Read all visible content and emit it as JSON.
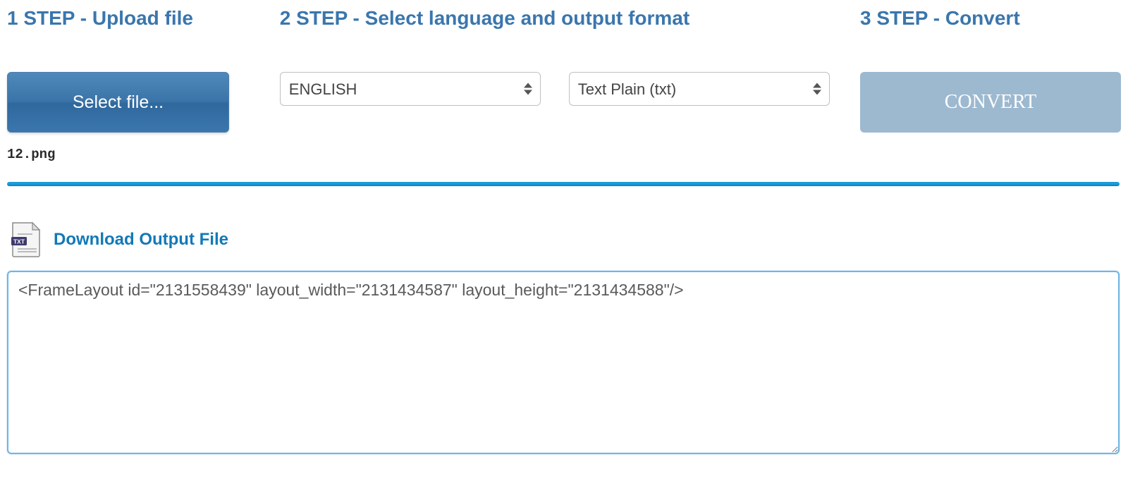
{
  "step1": {
    "header": "1 STEP - Upload file",
    "select_button_label": "Select file...",
    "uploaded_filename": "12.png"
  },
  "step2": {
    "header": "2 STEP - Select language and output format",
    "language_selected": "ENGLISH",
    "format_selected": "Text Plain (txt)"
  },
  "step3": {
    "header": "3 STEP - Convert",
    "convert_button_label": "CONVERT"
  },
  "result": {
    "download_link_label": "Download Output File",
    "output_text": "<FrameLayout id=\"2131558439\" layout_width=\"2131434587\" layout_height=\"2131434588\"/>"
  }
}
